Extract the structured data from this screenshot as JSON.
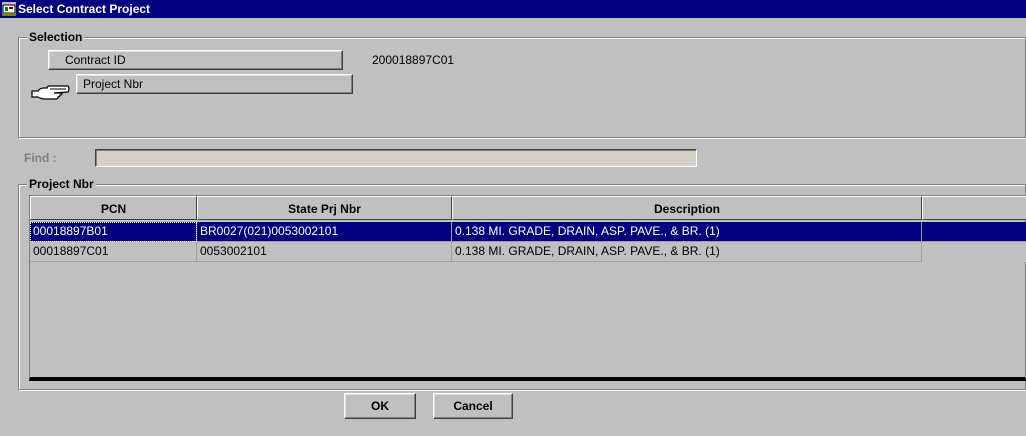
{
  "window": {
    "title": "Select Contract Project",
    "icon": "app-window-icon"
  },
  "selection": {
    "legend": "Selection",
    "contract_id_label": "Contract ID",
    "contract_id_value": "200018897C01",
    "project_nbr_label": "Project Nbr",
    "pointer_icon": "pointing-hand-icon"
  },
  "find": {
    "label": "Find :",
    "value": ""
  },
  "project": {
    "legend": "Project Nbr",
    "columns": [
      "PCN",
      "State Prj Nbr",
      "Description"
    ],
    "rows": [
      [
        "00018897B01",
        "BR0027(021)0053002101",
        "0.138 MI. GRADE, DRAIN, ASP. PAVE., & BR. (1)"
      ],
      [
        "00018897C01",
        "0053002101",
        "0.138 MI. GRADE, DRAIN, ASP. PAVE., & BR. (1)"
      ]
    ],
    "selected_row": 0
  },
  "buttons": {
    "ok": "OK",
    "cancel": "Cancel"
  },
  "colors": {
    "titlebar": "#000080",
    "selection": "#000080",
    "face": "#c0c0c0"
  }
}
